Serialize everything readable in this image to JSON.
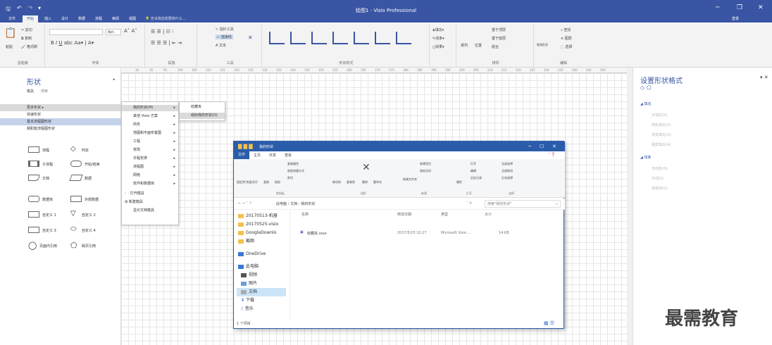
{
  "window": {
    "title": "绘图1 - Visio Professional",
    "signin": "登录"
  },
  "ribbon_tabs": [
    "文件",
    "开始",
    "插入",
    "设计",
    "数据",
    "流程",
    "审阅",
    "视图"
  ],
  "tellme": "告诉我您想要做什么...",
  "ribbon": {
    "clipboard": {
      "label": "剪贴板",
      "paste": "粘贴",
      "cut": "剪切",
      "copy": "复制",
      "format_painter": "格式刷"
    },
    "font": {
      "label": "字体",
      "size": "8pt."
    },
    "paragraph": {
      "label": "段落"
    },
    "tools": {
      "label": "工具",
      "pointer": "指针工具",
      "connector": "连接线",
      "text": "文本"
    },
    "shape_styles": {
      "label": "形状样式",
      "fill": "填充",
      "line": "线条",
      "effects": "效果"
    },
    "arrange": {
      "label": "排列",
      "align": "排列",
      "position": "位置",
      "bring_front": "置于顶层",
      "send_back": "置于底层",
      "group": "组合"
    },
    "editing": {
      "label": "编辑",
      "change_shape": "更改形状",
      "find": "查找",
      "layers": "图层",
      "select": "选择"
    }
  },
  "shapes": {
    "title": "形状",
    "tabs": [
      "模具",
      "搜索"
    ],
    "more": "更多形状",
    "quick": "快速形状",
    "basic": "基本流程图形状",
    "cross": "跨职能流程图形状",
    "items": [
      "流程",
      "判定",
      "子流程",
      "开始/结束",
      "文档",
      "数据",
      "数据库",
      "外部数据",
      "自定义 1",
      "自定义 2",
      "自定义 3",
      "自定义 4",
      "页面内引用",
      "跨页引用"
    ]
  },
  "more_menu": {
    "items": [
      "我的形状(M)",
      "其他 Visio 方案",
      "商务",
      "地图和平面布置图",
      "工程",
      "常规",
      "日程安排",
      "流程图",
      "网络",
      "软件和数据库",
      "打开模具",
      "新建模具",
      "显示文档模具"
    ]
  },
  "my_shapes_menu": {
    "items": [
      "收藏夹",
      "组织我的形状(O)"
    ]
  },
  "format_panel": {
    "title": "设置形状格式",
    "fill_section": "填充",
    "fill_opts": [
      "无填充(N)",
      "纯色填充(S)",
      "渐变填充(G)",
      "图案填充(A)"
    ],
    "line_section": "线条",
    "line_opts": [
      "无线条(N)",
      "实线(S)",
      "渐变线(G)"
    ]
  },
  "explorer": {
    "title": "我的形状",
    "tabs": [
      "文件",
      "主页",
      "共享",
      "查看"
    ],
    "ribbon": {
      "pin": "固定到'快速访问'",
      "copy": "复制",
      "paste": "粘贴",
      "copy_path": "复制路径",
      "paste_shortcut": "粘贴快捷方式",
      "cut": "剪切",
      "move_to": "移动到",
      "copy_to": "复制到",
      "delete": "删除",
      "rename": "重命名",
      "new_folder": "新建文件夹",
      "new_item": "新建项目",
      "easy_access": "轻松访问",
      "properties": "属性",
      "open": "打开",
      "edit": "编辑",
      "history": "历史记录",
      "select_all": "全部选择",
      "select_none": "全部取消",
      "invert": "反向选择",
      "groups": [
        "剪贴板",
        "组织",
        "新建",
        "打开",
        "选择"
      ]
    },
    "address": [
      "此电脑",
      "文档",
      "我的形状"
    ],
    "search": "搜索\"我的形状\"",
    "nav": [
      "20170513-机器",
      "20170525-visio",
      "GoogleDownlo",
      "截图",
      "OneDrive",
      "此电脑",
      "视频",
      "图片",
      "文档",
      "下载",
      "音乐"
    ],
    "columns": [
      "名称",
      "修改日期",
      "类型",
      "大小"
    ],
    "files": [
      {
        "name": "收藏夹.vssx",
        "date": "2017/5/25 10:27",
        "type": "Microsoft Visio ...",
        "size": "14 KB"
      }
    ],
    "status": "1 个项目"
  },
  "ruler": [
    "30",
    "35",
    "95",
    "100",
    "105",
    "110",
    "115",
    "120",
    "125",
    "130",
    "135",
    "140",
    "145",
    "150",
    "155",
    "160",
    "165",
    "170",
    "175",
    "180",
    "185",
    "190",
    "195",
    "200",
    "205",
    "210",
    "215",
    "220",
    "225",
    "230",
    "235",
    "240",
    "245",
    "250"
  ],
  "watermark": "最需教育"
}
